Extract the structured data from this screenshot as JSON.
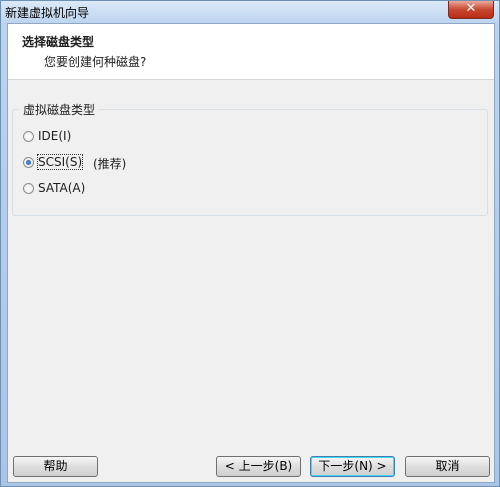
{
  "window": {
    "title": "新建虚拟机向导",
    "close_label": "✕"
  },
  "header": {
    "title": "选择磁盘类型",
    "subtitle": "您要创建何种磁盘?"
  },
  "disk_type": {
    "legend": "虚拟磁盘类型",
    "options": [
      {
        "label": "IDE(I)",
        "selected": false
      },
      {
        "label": "SCSI(S)",
        "selected": true,
        "hint": "(推荐)"
      },
      {
        "label": "SATA(A)",
        "selected": false
      }
    ]
  },
  "buttons": {
    "help": "帮助",
    "back": "< 上一步(B)",
    "next": "下一步(N) >",
    "cancel": "取消"
  }
}
